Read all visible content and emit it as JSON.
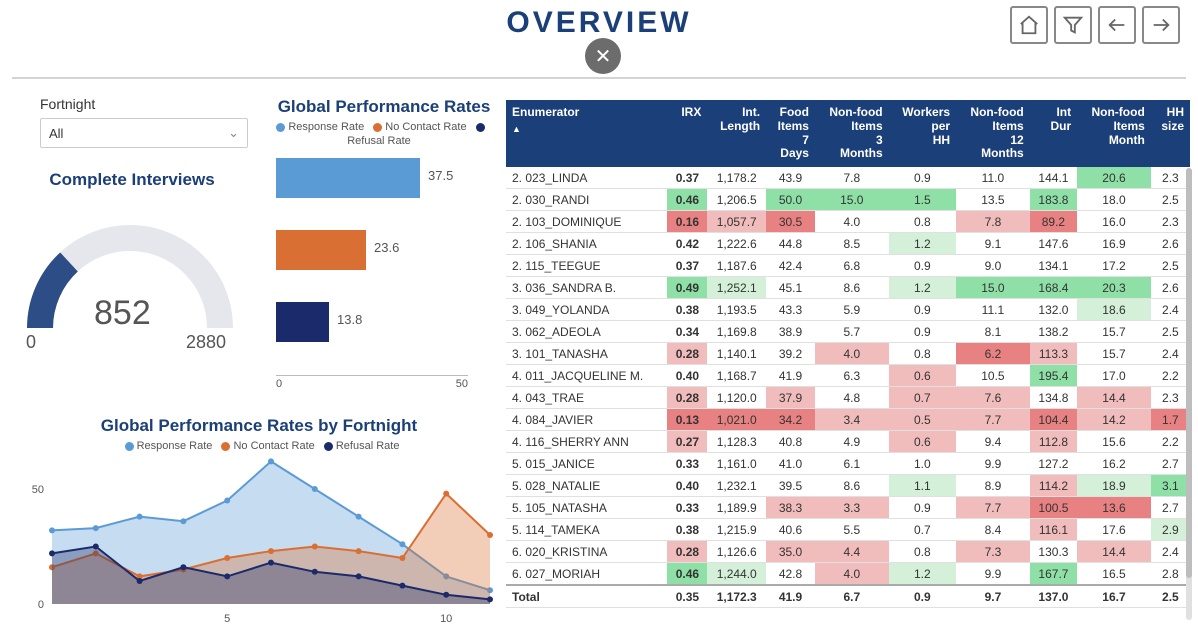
{
  "title": "OVERVIEW",
  "filter": {
    "label": "Fortnight",
    "value": "All"
  },
  "complete_interviews": {
    "title": "Complete Interviews",
    "value": "852",
    "min": "0",
    "max": "2880"
  },
  "gpr": {
    "title": "Global Performance Rates",
    "legend": {
      "response": "Response Rate",
      "no_contact": "No Contact Rate",
      "refusal": "Refusal Rate"
    },
    "axis_min": "0",
    "axis_max": "50"
  },
  "gprf": {
    "title": "Global Performance Rates by Fortnight",
    "legend": {
      "response": "Response Rate",
      "no_contact": "No Contact Rate",
      "refusal": "Refusal Rate"
    },
    "y_tick_50": "50",
    "y_tick_0": "0",
    "x_tick_5": "5",
    "x_tick_10": "10"
  },
  "table": {
    "headers": [
      "Enumerator",
      "IRX",
      "Int. Length",
      "Food Items 7 Days",
      "Non-food Items 3 Months",
      "Workers per HH",
      "Non-food Items 12 Months",
      "Int Dur",
      "Non-food Items Month",
      "HH size"
    ],
    "rows": [
      {
        "name": "2. 023_LINDA",
        "cells": [
          {
            "v": "0.37",
            "b": 1
          },
          {
            "v": "1,178.2"
          },
          {
            "v": "43.9"
          },
          {
            "v": "7.8"
          },
          {
            "v": "0.9"
          },
          {
            "v": "11.0"
          },
          {
            "v": "144.1"
          },
          {
            "v": "20.6",
            "c": "#8fe0a7"
          },
          {
            "v": "2.3"
          }
        ]
      },
      {
        "name": "2. 030_RANDI",
        "cells": [
          {
            "v": "0.46",
            "b": 1,
            "c": "#8fe0a7"
          },
          {
            "v": "1,206.5"
          },
          {
            "v": "50.0",
            "c": "#8fe0a7"
          },
          {
            "v": "15.0",
            "c": "#8fe0a7"
          },
          {
            "v": "1.5",
            "c": "#8fe0a7"
          },
          {
            "v": "13.5"
          },
          {
            "v": "183.8",
            "c": "#8fe0a7"
          },
          {
            "v": "18.0"
          },
          {
            "v": "2.5"
          }
        ]
      },
      {
        "name": "2. 103_DOMINIQUE",
        "cells": [
          {
            "v": "0.16",
            "b": 1,
            "c": "#e88282"
          },
          {
            "v": "1,057.7",
            "c": "#f1bcbc"
          },
          {
            "v": "30.5",
            "c": "#e88282"
          },
          {
            "v": "4.0"
          },
          {
            "v": "0.8"
          },
          {
            "v": "7.8",
            "c": "#f1bcbc"
          },
          {
            "v": "89.2",
            "c": "#e88282"
          },
          {
            "v": "16.0"
          },
          {
            "v": "2.3"
          }
        ]
      },
      {
        "name": "2. 106_SHANIA",
        "cells": [
          {
            "v": "0.42",
            "b": 1
          },
          {
            "v": "1,222.6"
          },
          {
            "v": "44.8"
          },
          {
            "v": "8.5"
          },
          {
            "v": "1.2",
            "c": "#d4f0d9"
          },
          {
            "v": "9.1"
          },
          {
            "v": "147.6"
          },
          {
            "v": "16.9"
          },
          {
            "v": "2.6"
          }
        ]
      },
      {
        "name": "2. 115_TEEGUE",
        "cells": [
          {
            "v": "0.37",
            "b": 1
          },
          {
            "v": "1,187.6"
          },
          {
            "v": "42.4"
          },
          {
            "v": "6.8"
          },
          {
            "v": "0.9"
          },
          {
            "v": "9.0"
          },
          {
            "v": "134.1"
          },
          {
            "v": "17.2"
          },
          {
            "v": "2.5"
          }
        ]
      },
      {
        "name": "3. 036_SANDRA B.",
        "cells": [
          {
            "v": "0.49",
            "b": 1,
            "c": "#8fe0a7"
          },
          {
            "v": "1,252.1",
            "c": "#d4f0d9"
          },
          {
            "v": "45.1"
          },
          {
            "v": "8.6"
          },
          {
            "v": "1.2",
            "c": "#d4f0d9"
          },
          {
            "v": "15.0",
            "c": "#8fe0a7"
          },
          {
            "v": "168.4",
            "c": "#8fe0a7"
          },
          {
            "v": "20.3",
            "c": "#8fe0a7"
          },
          {
            "v": "2.6"
          }
        ]
      },
      {
        "name": "3. 049_YOLANDA",
        "cells": [
          {
            "v": "0.38",
            "b": 1
          },
          {
            "v": "1,193.5"
          },
          {
            "v": "43.3"
          },
          {
            "v": "5.9"
          },
          {
            "v": "0.9"
          },
          {
            "v": "11.1"
          },
          {
            "v": "132.0"
          },
          {
            "v": "18.6",
            "c": "#d4f0d9"
          },
          {
            "v": "2.4"
          }
        ]
      },
      {
        "name": "3. 062_ADEOLA",
        "cells": [
          {
            "v": "0.34",
            "b": 1
          },
          {
            "v": "1,169.8"
          },
          {
            "v": "38.9"
          },
          {
            "v": "5.7"
          },
          {
            "v": "0.9"
          },
          {
            "v": "8.1"
          },
          {
            "v": "138.2"
          },
          {
            "v": "15.7"
          },
          {
            "v": "2.5"
          }
        ]
      },
      {
        "name": "3. 101_TANASHA",
        "cells": [
          {
            "v": "0.28",
            "b": 1,
            "c": "#f1bcbc"
          },
          {
            "v": "1,140.1"
          },
          {
            "v": "39.2"
          },
          {
            "v": "4.0",
            "c": "#f1bcbc"
          },
          {
            "v": "0.8"
          },
          {
            "v": "6.2",
            "c": "#e88282"
          },
          {
            "v": "113.3",
            "c": "#f1bcbc"
          },
          {
            "v": "15.7"
          },
          {
            "v": "2.4"
          }
        ]
      },
      {
        "name": "4. 011_JACQUELINE M.",
        "cells": [
          {
            "v": "0.40",
            "b": 1
          },
          {
            "v": "1,168.7"
          },
          {
            "v": "41.9"
          },
          {
            "v": "6.3"
          },
          {
            "v": "0.6",
            "c": "#f1bcbc"
          },
          {
            "v": "10.5"
          },
          {
            "v": "195.4",
            "c": "#8fe0a7"
          },
          {
            "v": "17.0"
          },
          {
            "v": "2.2"
          }
        ]
      },
      {
        "name": "4. 043_TRAE",
        "cells": [
          {
            "v": "0.28",
            "b": 1,
            "c": "#f1bcbc"
          },
          {
            "v": "1,120.0"
          },
          {
            "v": "37.9",
            "c": "#f1bcbc"
          },
          {
            "v": "4.8"
          },
          {
            "v": "0.7",
            "c": "#f1bcbc"
          },
          {
            "v": "7.6",
            "c": "#f1bcbc"
          },
          {
            "v": "134.8"
          },
          {
            "v": "14.4",
            "c": "#f1bcbc"
          },
          {
            "v": "2.3"
          }
        ]
      },
      {
        "name": "4. 084_JAVIER",
        "cells": [
          {
            "v": "0.13",
            "b": 1,
            "c": "#e88282"
          },
          {
            "v": "1,021.0",
            "c": "#e88282"
          },
          {
            "v": "34.2",
            "c": "#e88282"
          },
          {
            "v": "3.4",
            "c": "#f1bcbc"
          },
          {
            "v": "0.5",
            "c": "#f1bcbc"
          },
          {
            "v": "7.7",
            "c": "#f1bcbc"
          },
          {
            "v": "104.4",
            "c": "#e88282"
          },
          {
            "v": "14.2",
            "c": "#f1bcbc"
          },
          {
            "v": "1.7",
            "c": "#e88282"
          }
        ]
      },
      {
        "name": "4. 116_SHERRY ANN",
        "cells": [
          {
            "v": "0.27",
            "b": 1,
            "c": "#f1bcbc"
          },
          {
            "v": "1,128.3"
          },
          {
            "v": "40.8"
          },
          {
            "v": "4.9"
          },
          {
            "v": "0.6",
            "c": "#f1bcbc"
          },
          {
            "v": "9.4"
          },
          {
            "v": "112.8",
            "c": "#f1bcbc"
          },
          {
            "v": "15.6"
          },
          {
            "v": "2.2"
          }
        ]
      },
      {
        "name": "5. 015_JANICE",
        "cells": [
          {
            "v": "0.33",
            "b": 1
          },
          {
            "v": "1,161.0"
          },
          {
            "v": "41.0"
          },
          {
            "v": "6.1"
          },
          {
            "v": "1.0"
          },
          {
            "v": "9.9"
          },
          {
            "v": "127.2"
          },
          {
            "v": "16.2"
          },
          {
            "v": "2.7"
          }
        ]
      },
      {
        "name": "5. 028_NATALIE",
        "cells": [
          {
            "v": "0.40",
            "b": 1
          },
          {
            "v": "1,232.1"
          },
          {
            "v": "39.5"
          },
          {
            "v": "8.6"
          },
          {
            "v": "1.1",
            "c": "#d4f0d9"
          },
          {
            "v": "8.9"
          },
          {
            "v": "114.2",
            "c": "#f1bcbc"
          },
          {
            "v": "18.9",
            "c": "#d4f0d9"
          },
          {
            "v": "3.1",
            "c": "#8fe0a7"
          }
        ]
      },
      {
        "name": "5. 105_NATASHA",
        "cells": [
          {
            "v": "0.33",
            "b": 1
          },
          {
            "v": "1,189.9"
          },
          {
            "v": "38.3",
            "c": "#f1bcbc"
          },
          {
            "v": "3.3",
            "c": "#f1bcbc"
          },
          {
            "v": "0.9"
          },
          {
            "v": "7.7",
            "c": "#f1bcbc"
          },
          {
            "v": "100.5",
            "c": "#e88282"
          },
          {
            "v": "13.6",
            "c": "#e88282"
          },
          {
            "v": "2.7"
          }
        ]
      },
      {
        "name": "5. 114_TAMEKA",
        "cells": [
          {
            "v": "0.38",
            "b": 1
          },
          {
            "v": "1,215.9"
          },
          {
            "v": "40.6"
          },
          {
            "v": "5.5"
          },
          {
            "v": "0.7"
          },
          {
            "v": "8.4"
          },
          {
            "v": "116.1",
            "c": "#f1bcbc"
          },
          {
            "v": "17.6"
          },
          {
            "v": "2.9",
            "c": "#d4f0d9"
          }
        ]
      },
      {
        "name": "6. 020_KRISTINA",
        "cells": [
          {
            "v": "0.28",
            "b": 1,
            "c": "#f1bcbc"
          },
          {
            "v": "1,126.6"
          },
          {
            "v": "35.0",
            "c": "#f1bcbc"
          },
          {
            "v": "4.4",
            "c": "#f1bcbc"
          },
          {
            "v": "0.8"
          },
          {
            "v": "7.3",
            "c": "#f1bcbc"
          },
          {
            "v": "130.3"
          },
          {
            "v": "14.4",
            "c": "#f1bcbc"
          },
          {
            "v": "2.4"
          }
        ]
      },
      {
        "name": "6. 027_MORIAH",
        "cells": [
          {
            "v": "0.46",
            "b": 1,
            "c": "#8fe0a7"
          },
          {
            "v": "1,244.0",
            "c": "#d4f0d9"
          },
          {
            "v": "42.8"
          },
          {
            "v": "4.0",
            "c": "#f1bcbc"
          },
          {
            "v": "1.2",
            "c": "#d4f0d9"
          },
          {
            "v": "9.9"
          },
          {
            "v": "167.7",
            "c": "#8fe0a7"
          },
          {
            "v": "16.5"
          },
          {
            "v": "2.8"
          }
        ]
      }
    ],
    "total": {
      "name": "Total",
      "cells": [
        "0.35",
        "1,172.3",
        "41.9",
        "6.7",
        "0.9",
        "9.7",
        "137.0",
        "16.7",
        "2.5"
      ]
    }
  },
  "chart_data": [
    {
      "type": "gauge",
      "title": "Complete Interviews",
      "value": 852,
      "min": 0,
      "max": 2880
    },
    {
      "type": "bar",
      "title": "Global Performance Rates",
      "categories": [
        "Response Rate",
        "No Contact Rate",
        "Refusal Rate"
      ],
      "values": [
        37.5,
        23.6,
        13.8
      ],
      "colors": [
        "#5b9bd5",
        "#d96f32",
        "#1b2a6b"
      ],
      "xlabel": "",
      "ylabel": "",
      "xlim": [
        0,
        50
      ],
      "orientation": "horizontal"
    },
    {
      "type": "area",
      "title": "Global Performance Rates by Fortnight",
      "x": [
        1,
        2,
        3,
        4,
        5,
        6,
        7,
        8,
        9,
        10,
        11
      ],
      "series": [
        {
          "name": "Response Rate",
          "color": "#5b9bd5",
          "values": [
            32,
            33,
            38,
            36,
            45,
            62,
            50,
            38,
            26,
            12,
            6
          ]
        },
        {
          "name": "No Contact Rate",
          "color": "#d96f32",
          "values": [
            16,
            22,
            12,
            15,
            20,
            23,
            25,
            23,
            20,
            48,
            30
          ]
        },
        {
          "name": "Refusal Rate",
          "color": "#1b2a6b",
          "values": [
            22,
            25,
            10,
            16,
            12,
            18,
            14,
            12,
            8,
            4,
            2
          ]
        }
      ],
      "ylim": [
        0,
        60
      ],
      "xlabel": "",
      "ylabel": ""
    }
  ]
}
